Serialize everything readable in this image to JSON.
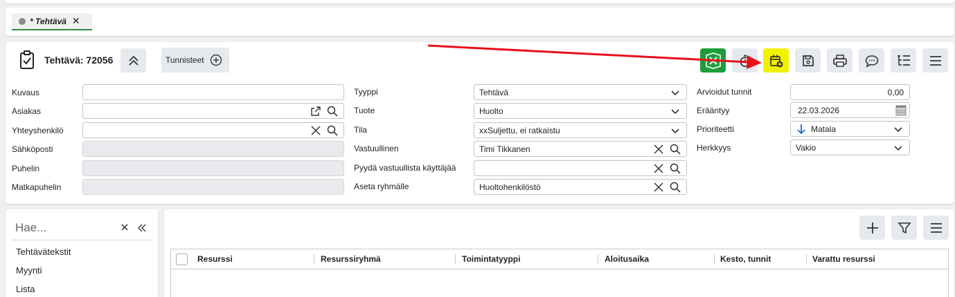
{
  "tab": {
    "label": "* Tehtävä",
    "close": "✕"
  },
  "header": {
    "title": "Tehtävä: 72056",
    "tags_label": "Tunnisteet"
  },
  "form": {
    "col1": [
      {
        "label": "Kuvaus",
        "value": ""
      },
      {
        "label": "Asiakas",
        "value": ""
      },
      {
        "label": "Yhteyshenkilö",
        "value": ""
      },
      {
        "label": "Sähköposti",
        "value": ""
      },
      {
        "label": "Puhelin",
        "value": ""
      },
      {
        "label": "Matkapuhelin",
        "value": ""
      }
    ],
    "col2": [
      {
        "label": "Tyyppi",
        "value": "Tehtävä"
      },
      {
        "label": "Tuote",
        "value": "Huolto"
      },
      {
        "label": "Tila",
        "value": "xxSuljettu, ei ratkaistu"
      },
      {
        "label": "Vastuullinen",
        "value": "Timi Tikkanen"
      },
      {
        "label": "Pyydä vastuullista käyttäjää",
        "value": ""
      },
      {
        "label": "Aseta ryhmälle",
        "value": "Huoltohenkilöstö"
      }
    ],
    "col3": [
      {
        "label": "Arvioidut tunnit",
        "value": "0,00"
      },
      {
        "label": "Erääntyy",
        "value": "22.03.2026"
      },
      {
        "label": "Prioriteetti",
        "value": "Matala"
      },
      {
        "label": "Herkkyys",
        "value": "Vakio"
      }
    ]
  },
  "sidebar": {
    "search_placeholder": "Hae...",
    "items": [
      "Tehtävätekstit",
      "Myynti",
      "Lista"
    ]
  },
  "grid": {
    "columns": [
      "Resurssi",
      "Resurssiryhmä",
      "Toimintatyyppi",
      "Aloitusaika",
      "Kesto, tunnit",
      "Varattu resurssi"
    ]
  },
  "colors": {
    "accent_green": "#1e9e3a",
    "highlight_yellow": "#f2f200",
    "annotation_red": "#e8101a",
    "priority_blue": "#1f6fd0"
  }
}
